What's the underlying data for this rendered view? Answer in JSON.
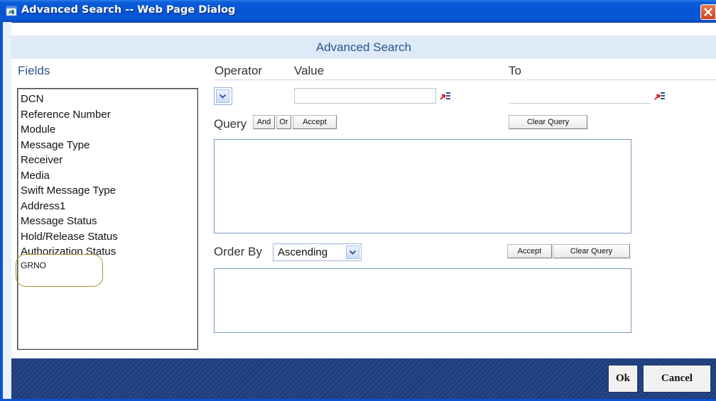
{
  "window": {
    "title": "Advanced Search -- Web Page Dialog",
    "icon": "ie-dialog-icon",
    "close_icon": "close-icon"
  },
  "header": {
    "title": "Advanced Search"
  },
  "labels": {
    "fields": "Fields",
    "operator": "Operator",
    "value": "Value",
    "to": "To",
    "query": "Query",
    "order_by": "Order By"
  },
  "fields": [
    "DCN",
    "Reference Number",
    "Module",
    "Message Type",
    "Receiver",
    "Media",
    "Swift Message Type",
    "Address1",
    "Message Status",
    "Hold/Release Status",
    "Authorization Status",
    "GRNO"
  ],
  "operator": {
    "selected": ""
  },
  "value_input": {
    "value": "",
    "lov_icon": "list-of-values-icon"
  },
  "to_input": {
    "value": "",
    "lov_icon": "list-of-values-icon"
  },
  "query_buttons": {
    "and": "And",
    "or": "Or",
    "accept": "Accept",
    "clear": "Clear Query"
  },
  "order": {
    "selected": "Ascending",
    "accept": "Accept",
    "clear": "Clear Query"
  },
  "footer": {
    "ok": "Ok",
    "cancel": "Cancel"
  },
  "colors": {
    "title_bar": "#0553d3",
    "header_bg": "#dfeaf8",
    "label_text": "#28548c",
    "footer_bg": "#1d3d7c",
    "highlight_oval": "#a89628"
  }
}
